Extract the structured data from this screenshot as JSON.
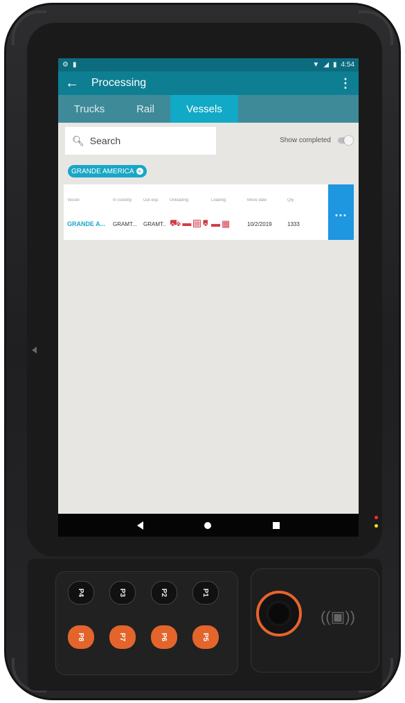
{
  "status_bar": {
    "left_icons": [
      "settings-icon",
      "sd-card-icon"
    ],
    "time": "4:54"
  },
  "app_bar": {
    "title": "Processing",
    "back_icon": "arrow-left-icon",
    "menu_icon": "more-vert-icon"
  },
  "tabs": [
    {
      "label": "Trucks",
      "active": false
    },
    {
      "label": "Rail",
      "active": false
    },
    {
      "label": "Vessels",
      "active": true
    }
  ],
  "search": {
    "placeholder": "Search",
    "icon": "search-icon"
  },
  "show_completed": {
    "label": "Show completed",
    "enabled": false
  },
  "filter_chip": {
    "label": "GRANDE AMERICA"
  },
  "table": {
    "columns": [
      "Vessel",
      "In custody",
      "Out exp.",
      "Unloading",
      "Loading",
      "Move date",
      "Qty"
    ],
    "row": {
      "vessel": "GRANDE A...",
      "in_custody": "GRAMT...",
      "out_exp": "GRAMT...",
      "unloading_icons": [
        "truck-icon",
        "car-icon",
        "container-icon",
        "truck-icon"
      ],
      "loading_icons": [
        "car-icon",
        "container-icon"
      ],
      "move_date": "10/2/2019",
      "qty": "1333"
    }
  },
  "more_button": {
    "label": "..."
  },
  "nav_bar": [
    "back-icon",
    "home-icon",
    "recents-icon"
  ],
  "keys": {
    "top": [
      "P4",
      "P3",
      "P2",
      "P1"
    ],
    "bottom": [
      "P8",
      "P7",
      "P6",
      "P5"
    ]
  },
  "colors": {
    "header": "#0e7f93",
    "tab_active": "#11a9c5",
    "accent": "#1aa6c8",
    "more_button": "#1e96e0",
    "icons_red": "#d23b48",
    "key_orange": "#e4652b"
  }
}
